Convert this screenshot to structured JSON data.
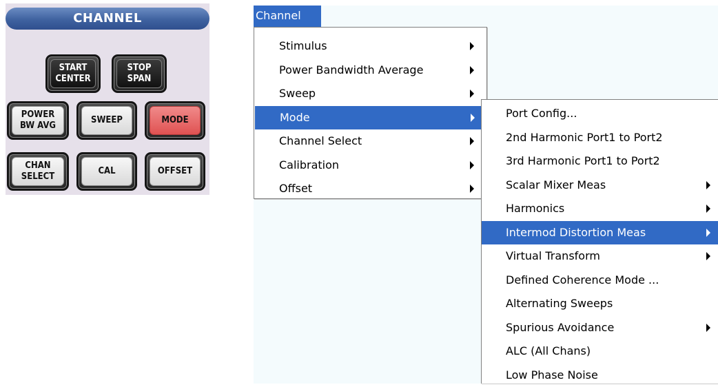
{
  "panel": {
    "title": "CHANNEL",
    "keys": [
      {
        "id": "start-center",
        "label": "START\nCENTER",
        "style": "dark"
      },
      {
        "id": "stop-span",
        "label": "STOP\nSPAN",
        "style": "dark"
      },
      {
        "id": "power-bw-avg",
        "label": "POWER\nBW AVG",
        "style": "light"
      },
      {
        "id": "sweep",
        "label": "SWEEP",
        "style": "light"
      },
      {
        "id": "mode",
        "label": "MODE",
        "style": "red"
      },
      {
        "id": "chan-select",
        "label": "CHAN\nSELECT",
        "style": "light"
      },
      {
        "id": "cal",
        "label": "CAL",
        "style": "light"
      },
      {
        "id": "offset",
        "label": "OFFSET",
        "style": "light"
      }
    ]
  },
  "menubar": {
    "label": "Channel"
  },
  "channel_menu": {
    "items": [
      {
        "label": "Stimulus",
        "submenu": true,
        "highlighted": false
      },
      {
        "label": "Power Bandwidth Average",
        "submenu": true,
        "highlighted": false
      },
      {
        "label": "Sweep",
        "submenu": true,
        "highlighted": false
      },
      {
        "label": "Mode",
        "submenu": true,
        "highlighted": true
      },
      {
        "label": "Channel Select",
        "submenu": true,
        "highlighted": false
      },
      {
        "label": "Calibration",
        "submenu": true,
        "highlighted": false
      },
      {
        "label": "Offset",
        "submenu": true,
        "highlighted": false
      }
    ]
  },
  "mode_menu": {
    "items": [
      {
        "label": "Port Config...",
        "submenu": false,
        "highlighted": false
      },
      {
        "label": "2nd Harmonic Port1 to Port2",
        "submenu": false,
        "highlighted": false
      },
      {
        "label": "3rd Harmonic Port1 to Port2",
        "submenu": false,
        "highlighted": false
      },
      {
        "label": "Scalar Mixer Meas",
        "submenu": true,
        "highlighted": false
      },
      {
        "label": "Harmonics",
        "submenu": true,
        "highlighted": false
      },
      {
        "label": "Intermod Distortion Meas",
        "submenu": true,
        "highlighted": true
      },
      {
        "label": "Virtual Transform",
        "submenu": true,
        "highlighted": false
      },
      {
        "label": "Defined Coherence Mode ...",
        "submenu": false,
        "highlighted": false
      },
      {
        "label": "Alternating Sweeps",
        "submenu": false,
        "highlighted": false
      },
      {
        "label": "Spurious Avoidance",
        "submenu": true,
        "highlighted": false
      },
      {
        "label": "ALC (All Chans)",
        "submenu": false,
        "highlighted": false
      },
      {
        "label": "Low Phase Noise",
        "submenu": false,
        "highlighted": false
      }
    ]
  },
  "colors": {
    "highlight": "#316ac5",
    "panel_bg": "#e6e0ea",
    "title_bar": "#3f62a0",
    "mode_key": "#e05252",
    "screen_bg": "#f4fbfd"
  }
}
